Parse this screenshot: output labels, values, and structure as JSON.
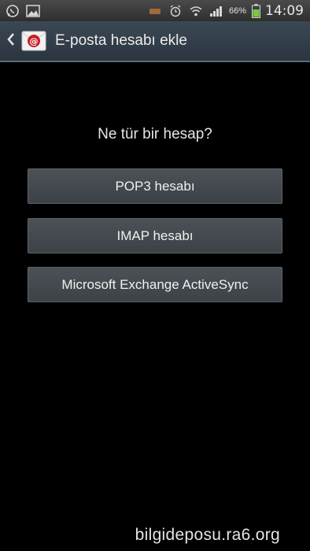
{
  "status_bar": {
    "battery_percent": "66%",
    "time": "14:09",
    "icons": [
      "whatsapp-icon",
      "gallery-icon",
      "battery-saver-icon",
      "alarm-icon",
      "wifi-icon",
      "signal-icon",
      "battery-icon"
    ]
  },
  "action_bar": {
    "title": "E-posta hesabı ekle",
    "app_icon": "email-icon"
  },
  "main": {
    "question": "Ne tür bir hesap?",
    "options": [
      {
        "label": "POP3 hesabı"
      },
      {
        "label": "IMAP hesabı"
      },
      {
        "label": "Microsoft Exchange ActiveSync"
      }
    ]
  },
  "watermark": "bilgideposu.ra6.org",
  "colors": {
    "action_bar": "#323e49",
    "button": "#45494e",
    "background": "#000000",
    "battery_fill": "#7ac943"
  }
}
